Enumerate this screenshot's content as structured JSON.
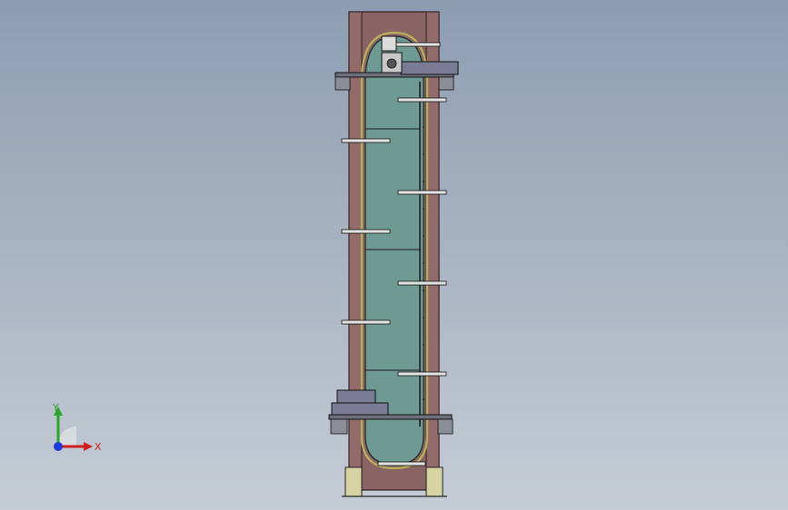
{
  "viewport": {
    "background_top": "#8d9db1",
    "background_bottom": "#c5ccd6"
  },
  "model": {
    "frame_color": "#8a6464",
    "panel_color": "#6f9a93",
    "belt_color": "#b9b15a",
    "bracket_color": "#7a7c95"
  },
  "triad": {
    "x_label": "X",
    "y_label": "Y",
    "x_color": "#d21e1e",
    "y_color": "#2aa52a",
    "z_color": "#1e3ad2"
  }
}
